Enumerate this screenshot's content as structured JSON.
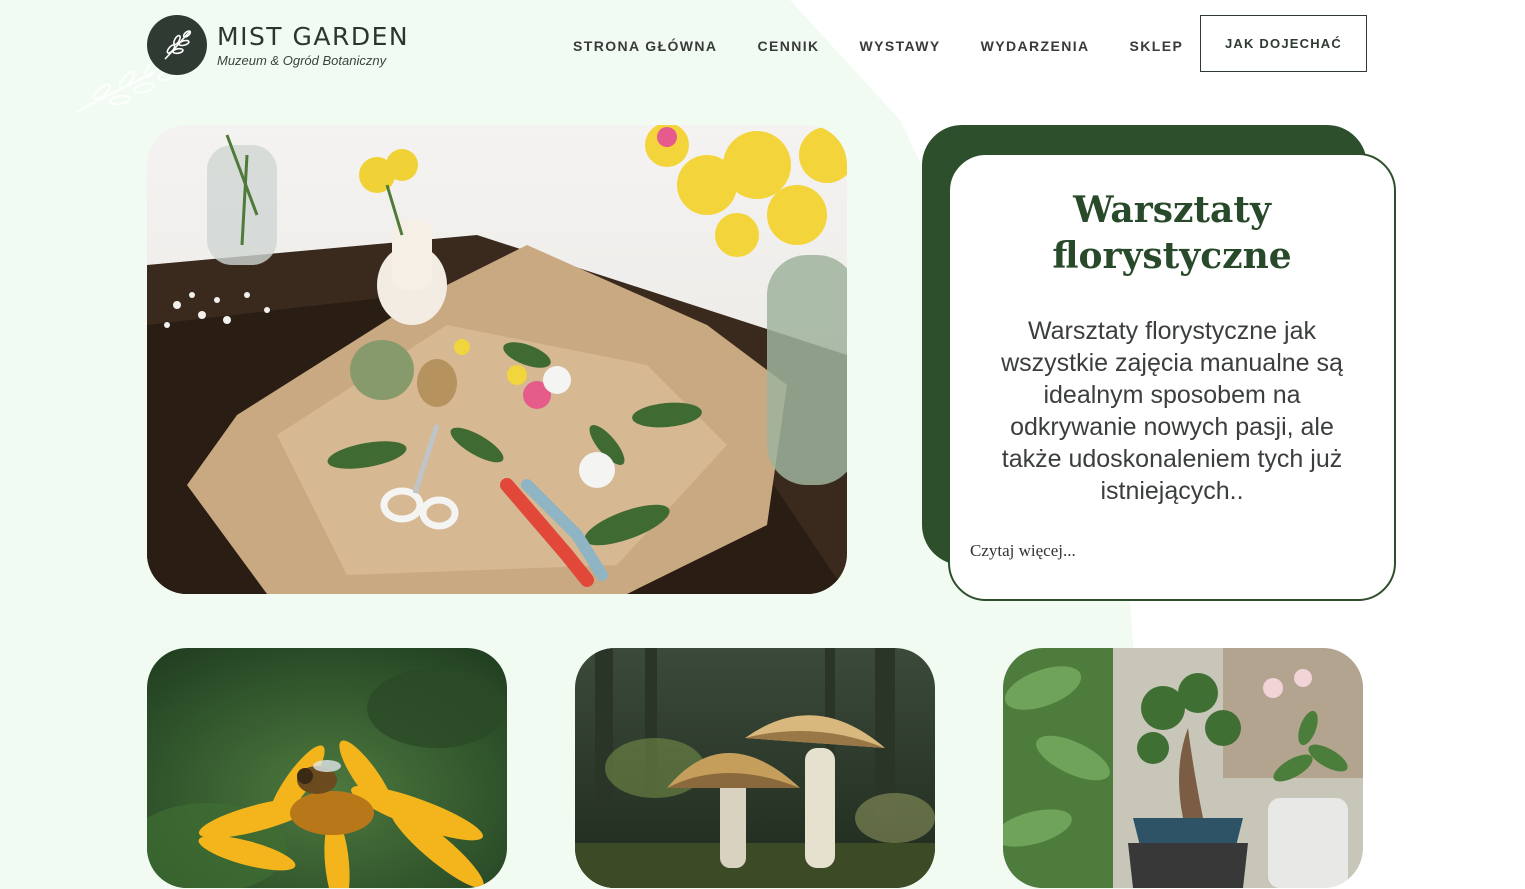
{
  "brand": {
    "name": "MIST GARDEN",
    "tagline": "Muzeum & Ogród Botaniczny"
  },
  "nav": {
    "items": [
      {
        "label": "STRONA GŁÓWNA"
      },
      {
        "label": "CENNIK"
      },
      {
        "label": "WYSTAWY"
      },
      {
        "label": "WYDARZENIA"
      },
      {
        "label": "SKLEP"
      }
    ],
    "cta_label": "JAK DOJECHAĆ"
  },
  "featured": {
    "title": "Warsztaty florystyczne",
    "text": "Warsztaty florystyczne jak wszystkie zajęcia manualne są idealnym sposobem na odkrywanie nowych pasji, ale także udoskonaleniem tych już istniejących..",
    "link_label": "Czytaj więcej..."
  },
  "colors": {
    "dark_green": "#2e4f2c",
    "logo_bg": "#2e3a32",
    "page_bg": "#f1fbf2"
  }
}
